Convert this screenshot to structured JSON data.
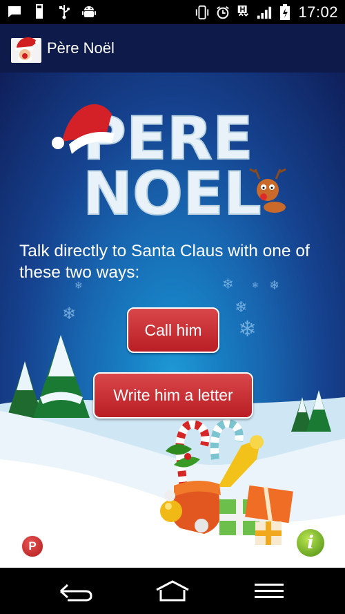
{
  "status_bar": {
    "time": "17:02",
    "left_icons": [
      "message-icon",
      "usb-icon",
      "usb-debug-icon",
      "android-icon"
    ],
    "right_icons": [
      "vibrate-icon",
      "alarm-icon",
      "hspa-icon",
      "signal-icon",
      "battery-icon"
    ],
    "network_label": "H"
  },
  "action_bar": {
    "title": "Père Noël",
    "background": "#0d1a4a"
  },
  "main": {
    "logo_line1": "PERE",
    "logo_line2": "NOEL",
    "tagline": "Talk directly to Santa Claus with one of these two ways:",
    "call_button": "Call him",
    "letter_button": "Write him a letter",
    "badge_label": "P",
    "info_label": "i"
  },
  "nav_bar": {
    "items": [
      "back-icon",
      "home-icon",
      "menu-icon"
    ]
  },
  "colors": {
    "button_red": "#c62a2f",
    "sky_blue": "#1a78c0",
    "night_blue": "#0f1f5a",
    "info_green": "#6fb21f"
  }
}
